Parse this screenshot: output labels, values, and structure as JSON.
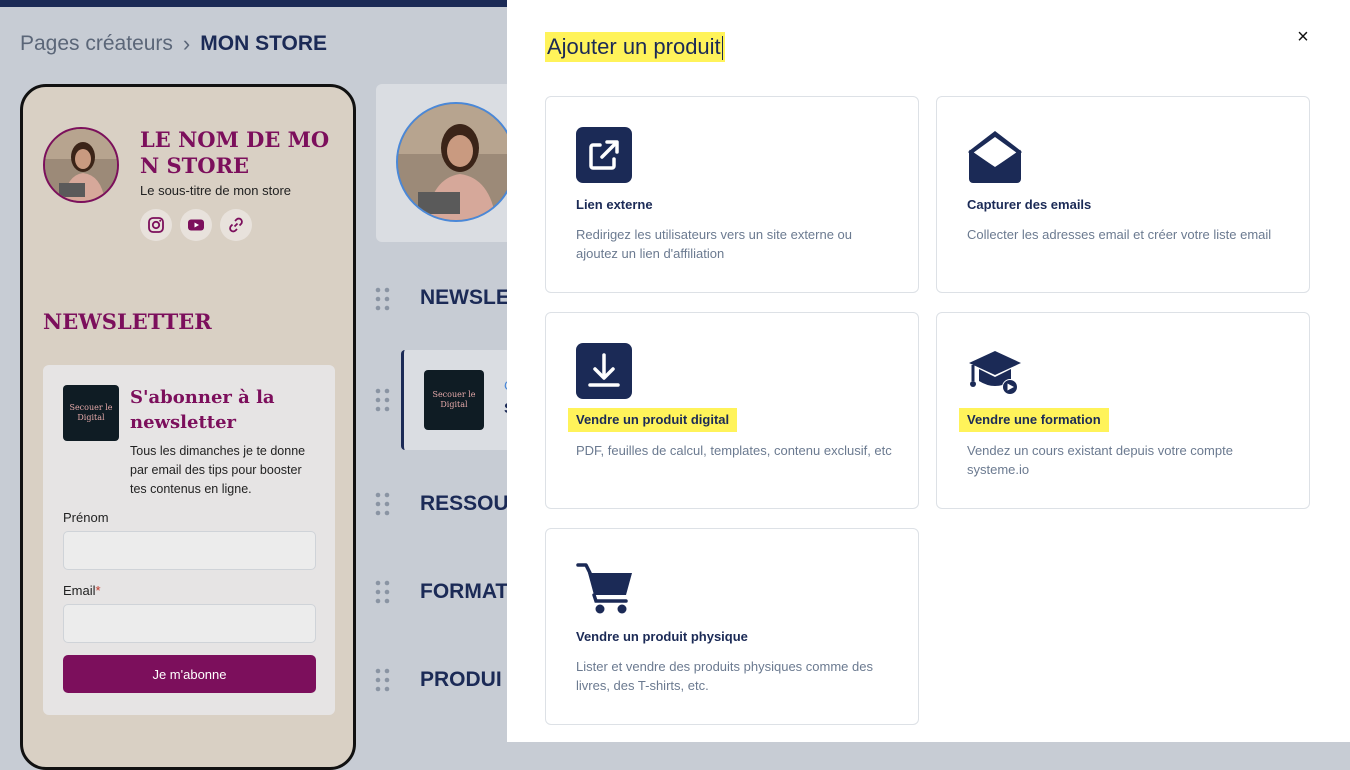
{
  "breadcrumb": {
    "parent": "Pages créateurs",
    "separator": "›",
    "current": "MON STORE"
  },
  "store_preview": {
    "name": "LE NOM DE MON STORE",
    "subtitle": "Le sous-titre de mon store",
    "social_icons": [
      "instagram-icon",
      "youtube-icon",
      "link-icon"
    ],
    "newsletter_heading": "NEWSLETTER",
    "newsletter_card": {
      "thumb_text": "Secouer le Digital",
      "title": "S'abonner à la newsletter",
      "description": "Tous les dimanches je te donne par email des tips pour booster tes contenus en ligne.",
      "firstname_label": "Prénom",
      "email_label": "Email",
      "required_mark": "*",
      "button_label": "Je m'abonne"
    }
  },
  "sections": {
    "newsletter": "NEWSLE",
    "product_thumb_text": "Secouer le Digital",
    "product_cut_a": "C",
    "product_cut_b": "S",
    "ressources": "RESSOU",
    "formations": "FORMAT",
    "produits": "PRODUI"
  },
  "modal": {
    "title": "Ajouter un produit",
    "close_icon": "close-icon",
    "close_glyph": "×",
    "highlight_color": "#fff35a",
    "options": [
      {
        "icon": "external-link-icon",
        "title": "Lien externe",
        "description": "Redirigez les utilisateurs vers un site externe ou ajoutez un lien d'affiliation"
      },
      {
        "icon": "envelope-icon",
        "title": "Capturer des emails",
        "description": "Collecter les adresses email et créer votre liste email"
      },
      {
        "icon": "download-icon",
        "title": "Vendre un produit digital",
        "description": "PDF, feuilles de calcul, templates, contenu exclusif, etc"
      },
      {
        "icon": "graduation-cap-icon",
        "title": "Vendre une formation",
        "description": "Vendez un cours existant depuis votre compte systeme.io"
      },
      {
        "icon": "shopping-cart-icon",
        "title": "Vendre un produit physique",
        "description": "Lister et vendre des produits physiques comme des livres, des T-shirts, etc."
      }
    ]
  },
  "colors": {
    "brand_navy": "#1b2a56",
    "store_accent": "#7c0f5c"
  }
}
